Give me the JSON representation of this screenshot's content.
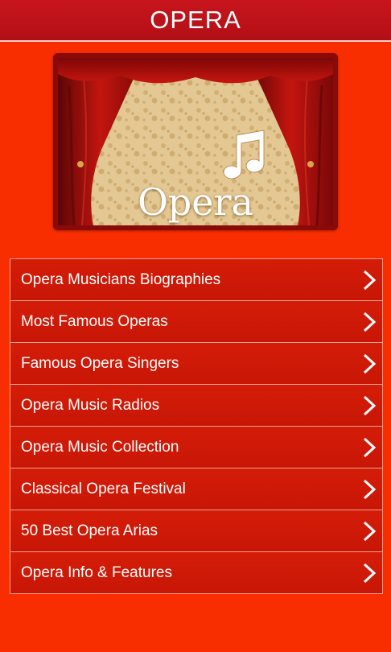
{
  "header": {
    "title": "OPERA"
  },
  "banner": {
    "caption": "Opera",
    "icon": "music-note-icon"
  },
  "menu": {
    "items": [
      {
        "label": "Opera Musicians Biographies"
      },
      {
        "label": "Most Famous Operas"
      },
      {
        "label": "Famous Opera Singers"
      },
      {
        "label": "Opera Music Radios"
      },
      {
        "label": "Opera Music Collection"
      },
      {
        "label": "Classical Opera Festival"
      },
      {
        "label": "50 Best Opera Arias"
      },
      {
        "label": "Opera Info & Features"
      }
    ],
    "chevron_icon": "chevron-right-icon"
  },
  "colors": {
    "background": "#f92e00",
    "header": "#c8151c",
    "menu_item": "#d41d08",
    "curtain": "#b3110e",
    "wallpaper": "#e4c893"
  }
}
